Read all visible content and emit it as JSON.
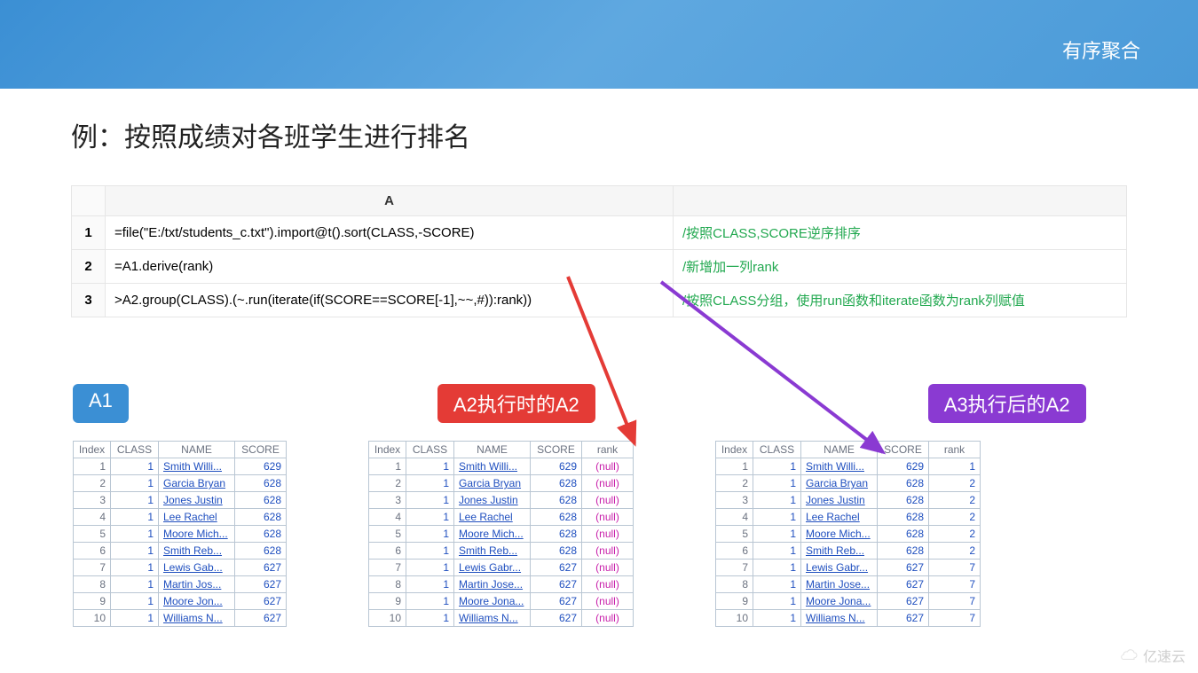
{
  "header": {
    "section_label": "有序聚合"
  },
  "title": "例：按照成绩对各班学生进行排名",
  "code_table": {
    "col_header": "A",
    "rows": [
      {
        "num": "1",
        "code": "=file(\"E:/txt/students_c.txt\").import@t().sort(CLASS,-SCORE)",
        "comment": "/按照CLASS,SCORE逆序排序"
      },
      {
        "num": "2",
        "code": "=A1.derive(rank)",
        "comment": "/新增加一列rank"
      },
      {
        "num": "3",
        "code": ">A2.group(CLASS).(~.run(iterate(if(SCORE==SCORE[-1],~~,#)):rank))",
        "comment": "/按照CLASS分组，使用run函数和iterate函数为rank列赋值"
      }
    ]
  },
  "badges": {
    "a1": "A1",
    "a2": "A2执行时的A2",
    "a3": "A3执行后的A2"
  },
  "table_a1": {
    "headers": [
      "Index",
      "CLASS",
      "NAME",
      "SCORE"
    ],
    "rows": [
      {
        "idx": "1",
        "cls": "1",
        "nm": "Smith Willi...",
        "sc": "629"
      },
      {
        "idx": "2",
        "cls": "1",
        "nm": "Garcia Bryan",
        "sc": "628"
      },
      {
        "idx": "3",
        "cls": "1",
        "nm": "Jones Justin",
        "sc": "628"
      },
      {
        "idx": "4",
        "cls": "1",
        "nm": "Lee Rachel",
        "sc": "628"
      },
      {
        "idx": "5",
        "cls": "1",
        "nm": "Moore Mich...",
        "sc": "628"
      },
      {
        "idx": "6",
        "cls": "1",
        "nm": "Smith Reb...",
        "sc": "628"
      },
      {
        "idx": "7",
        "cls": "1",
        "nm": "Lewis Gab...",
        "sc": "627"
      },
      {
        "idx": "8",
        "cls": "1",
        "nm": "Martin Jos...",
        "sc": "627"
      },
      {
        "idx": "9",
        "cls": "1",
        "nm": "Moore Jon...",
        "sc": "627"
      },
      {
        "idx": "10",
        "cls": "1",
        "nm": "Williams N...",
        "sc": "627"
      }
    ]
  },
  "table_a2": {
    "headers": [
      "Index",
      "CLASS",
      "NAME",
      "SCORE",
      "rank"
    ],
    "null_text": "(null)",
    "rows": [
      {
        "idx": "1",
        "cls": "1",
        "nm": "Smith Willi...",
        "sc": "629"
      },
      {
        "idx": "2",
        "cls": "1",
        "nm": "Garcia Bryan",
        "sc": "628"
      },
      {
        "idx": "3",
        "cls": "1",
        "nm": "Jones Justin",
        "sc": "628"
      },
      {
        "idx": "4",
        "cls": "1",
        "nm": "Lee Rachel",
        "sc": "628"
      },
      {
        "idx": "5",
        "cls": "1",
        "nm": "Moore Mich...",
        "sc": "628"
      },
      {
        "idx": "6",
        "cls": "1",
        "nm": "Smith Reb...",
        "sc": "628"
      },
      {
        "idx": "7",
        "cls": "1",
        "nm": "Lewis Gabr...",
        "sc": "627"
      },
      {
        "idx": "8",
        "cls": "1",
        "nm": "Martin Jose...",
        "sc": "627"
      },
      {
        "idx": "9",
        "cls": "1",
        "nm": "Moore Jona...",
        "sc": "627"
      },
      {
        "idx": "10",
        "cls": "1",
        "nm": "Williams N...",
        "sc": "627"
      }
    ]
  },
  "table_a3": {
    "headers": [
      "Index",
      "CLASS",
      "NAME",
      "SCORE",
      "rank"
    ],
    "rows": [
      {
        "idx": "1",
        "cls": "1",
        "nm": "Smith Willi...",
        "sc": "629",
        "rk": "1"
      },
      {
        "idx": "2",
        "cls": "1",
        "nm": "Garcia Bryan",
        "sc": "628",
        "rk": "2"
      },
      {
        "idx": "3",
        "cls": "1",
        "nm": "Jones Justin",
        "sc": "628",
        "rk": "2"
      },
      {
        "idx": "4",
        "cls": "1",
        "nm": "Lee Rachel",
        "sc": "628",
        "rk": "2"
      },
      {
        "idx": "5",
        "cls": "1",
        "nm": "Moore Mich...",
        "sc": "628",
        "rk": "2"
      },
      {
        "idx": "6",
        "cls": "1",
        "nm": "Smith Reb...",
        "sc": "628",
        "rk": "2"
      },
      {
        "idx": "7",
        "cls": "1",
        "nm": "Lewis Gabr...",
        "sc": "627",
        "rk": "7"
      },
      {
        "idx": "8",
        "cls": "1",
        "nm": "Martin Jose...",
        "sc": "627",
        "rk": "7"
      },
      {
        "idx": "9",
        "cls": "1",
        "nm": "Moore Jona...",
        "sc": "627",
        "rk": "7"
      },
      {
        "idx": "10",
        "cls": "1",
        "nm": "Williams N...",
        "sc": "627",
        "rk": "7"
      }
    ]
  },
  "watermark": "亿速云"
}
